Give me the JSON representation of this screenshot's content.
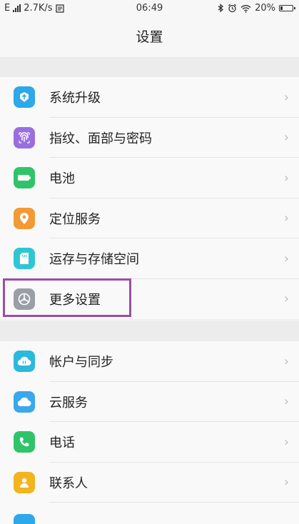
{
  "status_bar": {
    "network": "E",
    "speed": "2.7K/s",
    "time": "06:49",
    "battery": "20%"
  },
  "header": {
    "title": "设置"
  },
  "group1": [
    {
      "label": "系统升级",
      "icon": "system-update-icon",
      "color": "#2da8e8"
    },
    {
      "label": "指纹、面部与密码",
      "icon": "fingerprint-icon",
      "color": "#9b6ee0"
    },
    {
      "label": "电池",
      "icon": "battery-icon",
      "color": "#30c46a"
    },
    {
      "label": "定位服务",
      "icon": "location-icon",
      "color": "#f29a35"
    },
    {
      "label": "运存与存储空间",
      "icon": "storage-icon",
      "color": "#2fc6d4"
    },
    {
      "label": "更多设置",
      "icon": "more-settings-icon",
      "color": "#9a9ea6"
    }
  ],
  "group2": [
    {
      "label": "帐户与同步",
      "icon": "account-sync-icon",
      "color": "#2bb9de"
    },
    {
      "label": "云服务",
      "icon": "cloud-service-icon",
      "color": "#3aa8ea"
    },
    {
      "label": "电话",
      "icon": "phone-icon",
      "color": "#30c46a"
    },
    {
      "label": "联系人",
      "icon": "contacts-icon",
      "color": "#f2b41f"
    }
  ]
}
